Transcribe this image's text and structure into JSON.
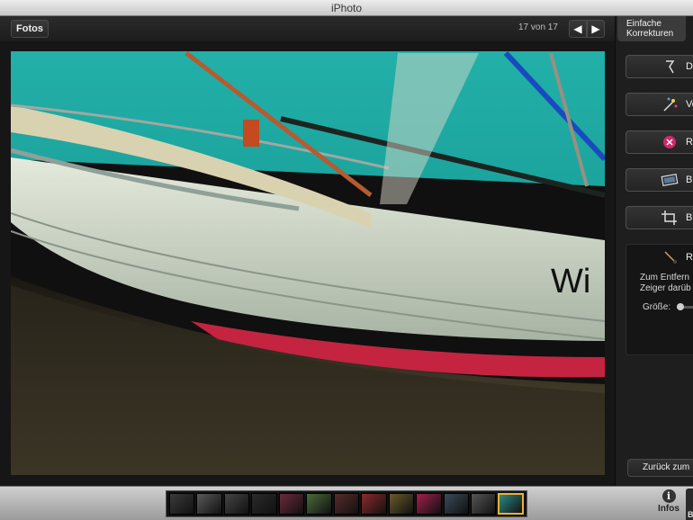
{
  "window": {
    "title": "iPhoto"
  },
  "toolbar": {
    "back_label": "Fotos",
    "counter": "17 von 17",
    "prev_icon": "arrow-left",
    "next_icon": "arrow-right"
  },
  "panel": {
    "tab_label_line1": "Einfache",
    "tab_label_line2": "Korrekturen",
    "buttons": [
      {
        "label": "D",
        "icon": "rotate-icon"
      },
      {
        "label": "Ve",
        "icon": "magic-wand-icon"
      },
      {
        "label": "R",
        "icon": "red-eye-icon"
      },
      {
        "label": "B",
        "icon": "straighten-icon"
      },
      {
        "label": "B",
        "icon": "crop-icon"
      }
    ],
    "retouch": {
      "label": "R",
      "icon": "brush-icon",
      "help_line1": "Zum Entfern",
      "help_line2": "Zeiger darüb",
      "size_label": "Größe:"
    },
    "back_button": "Zurück zum"
  },
  "bottombar": {
    "info_label": "Infos",
    "edit_label": "B",
    "thumbnail_count": 13,
    "selected_index": 12
  },
  "colors": {
    "water": "#1fa5a0",
    "boat_hull": "#c9d2c2",
    "hull_red": "#c4243f",
    "selection": "#f0b030"
  }
}
